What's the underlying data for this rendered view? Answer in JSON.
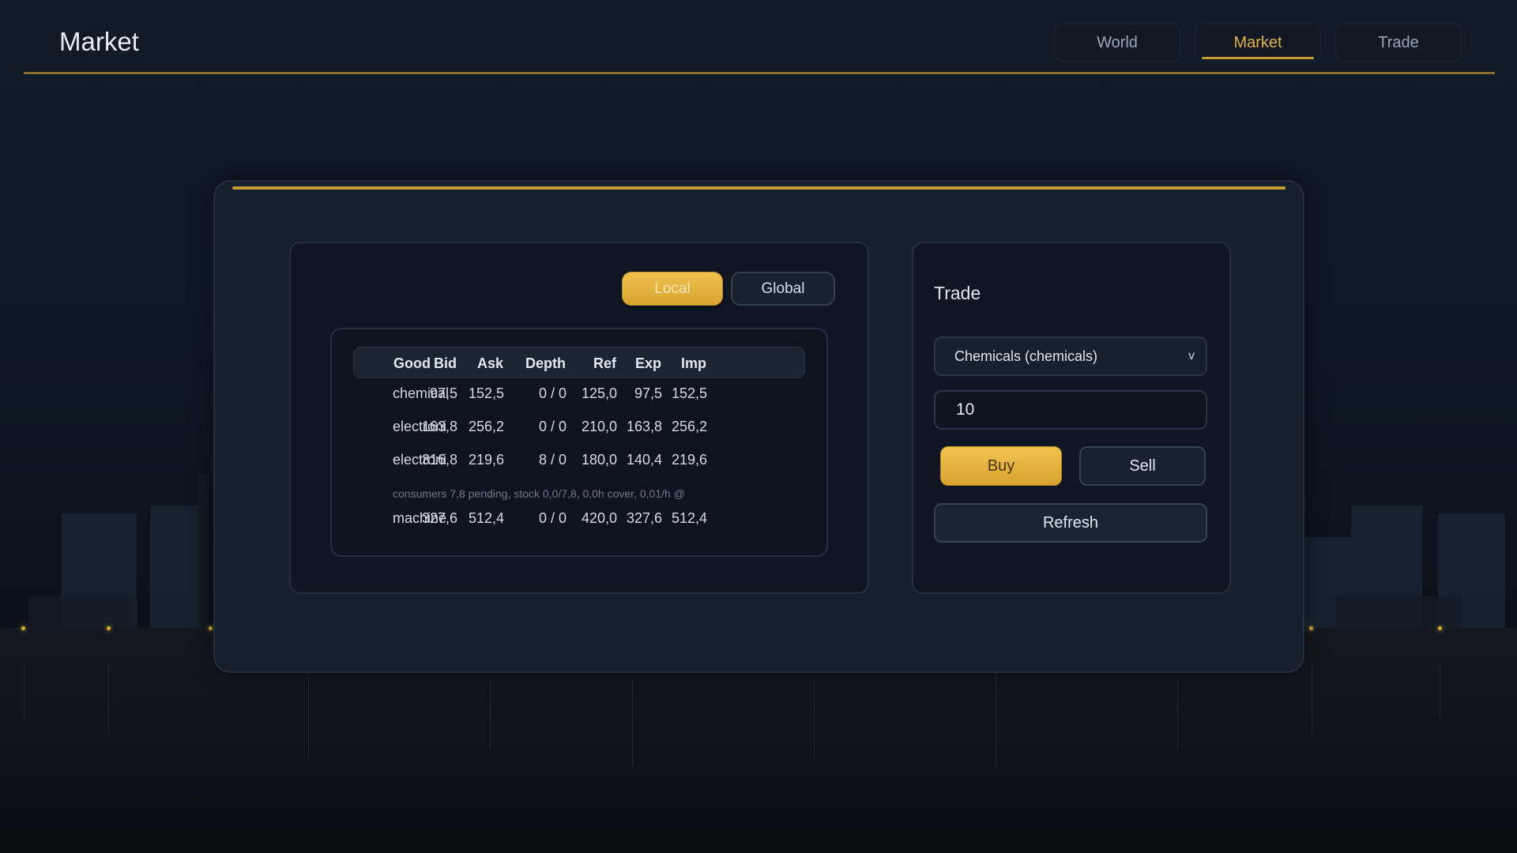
{
  "app": {
    "title": "Market"
  },
  "nav": {
    "tabs": [
      {
        "label": "World",
        "active": false
      },
      {
        "label": "Market",
        "active": true
      },
      {
        "label": "Trade",
        "active": false
      }
    ]
  },
  "market": {
    "scope_local": "Local",
    "scope_global": "Global",
    "columns": [
      "Good",
      "Bid",
      "Ask",
      "Depth",
      "Ref",
      "Exp",
      "Imp"
    ],
    "rows": [
      {
        "good": "chemical",
        "bid": "97,5",
        "ask": "152,5",
        "depth": "0 / 0",
        "ref": "125,0",
        "exp": "97,5",
        "imp": "152,5"
      },
      {
        "good": "electroni",
        "bid": "163,8",
        "ask": "256,2",
        "depth": "0 / 0",
        "ref": "210,0",
        "exp": "163,8",
        "imp": "256,2"
      },
      {
        "good": "electroni",
        "bid": "316,8",
        "ask": "219,6",
        "depth": "8 / 0",
        "ref": "180,0",
        "exp": "140,4",
        "imp": "219,6"
      },
      {
        "good": "machine",
        "bid": "327,6",
        "ask": "512,4",
        "depth": "0 / 0",
        "ref": "420,0",
        "exp": "327,6",
        "imp": "512,4"
      }
    ],
    "note": "consumers 7,8 pending, stock 0,0/7,8, 0,0h cover, 0,01/h @"
  },
  "trade": {
    "title": "Trade",
    "selected_good": "Chemicals (chemicals)",
    "select_chevron": "v",
    "quantity": "10",
    "buy_label": "Buy",
    "sell_label": "Sell",
    "refresh_label": "Refresh"
  },
  "colors": {
    "accent": "#d9a531",
    "background": "#0f1723",
    "panel": "#161f2c"
  }
}
